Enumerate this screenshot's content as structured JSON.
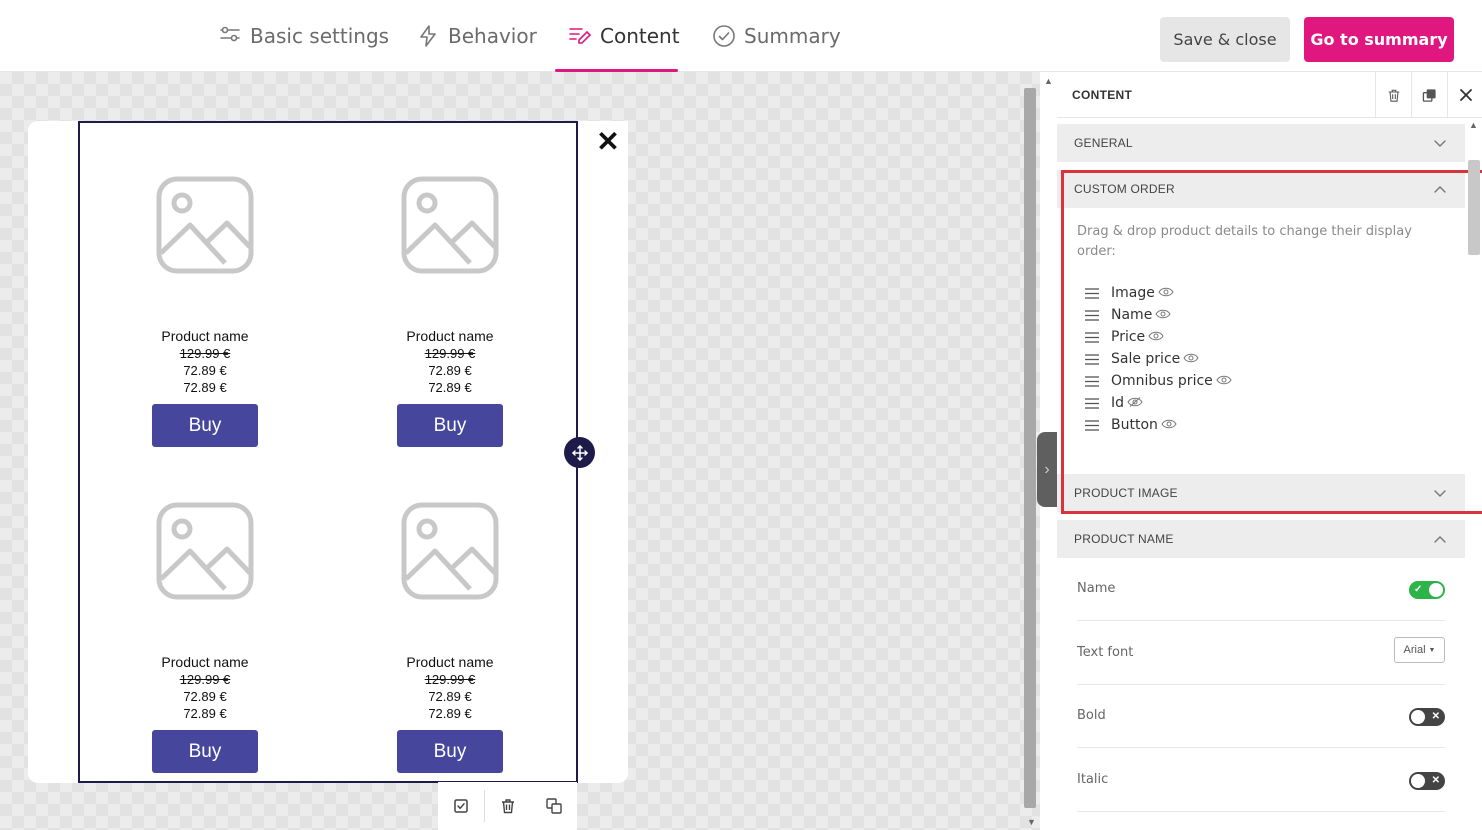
{
  "tabs": [
    {
      "label": "Basic settings",
      "icon": "sliders-icon"
    },
    {
      "label": "Behavior",
      "icon": "lightning-icon"
    },
    {
      "label": "Content",
      "icon": "content-edit-icon"
    },
    {
      "label": "Summary",
      "icon": "check-circle-icon"
    }
  ],
  "active_tab": "Content",
  "actions": {
    "save_close": "Save & close",
    "go_summary": "Go to summary"
  },
  "colors": {
    "accent": "#e0177f",
    "buy_button": "#46479c",
    "selection": "#1e1a4a",
    "toggle_on": "#2cb34a",
    "highlight": "#d9343b"
  },
  "products": [
    {
      "name": "Product name",
      "old_price": "129.99 €",
      "price": "72.89 €",
      "omnibus_price": "72.89 €",
      "button": "Buy"
    },
    {
      "name": "Product name",
      "old_price": "129.99 €",
      "price": "72.89 €",
      "omnibus_price": "72.89 €",
      "button": "Buy"
    },
    {
      "name": "Product name",
      "old_price": "129.99 €",
      "price": "72.89 €",
      "omnibus_price": "72.89 €",
      "button": "Buy"
    },
    {
      "name": "Product name",
      "old_price": "129.99 €",
      "price": "72.89 €",
      "omnibus_price": "72.89 €",
      "button": "Buy"
    }
  ],
  "canvas_close": "✕",
  "panel": {
    "title": "CONTENT",
    "sections": {
      "general": "GENERAL",
      "custom_order": "CUSTOM ORDER",
      "product_image": "PRODUCT IMAGE",
      "product_name": "PRODUCT NAME"
    },
    "custom_order_instructions": "Drag & drop product details to change their display order:",
    "order_items": [
      {
        "label": "Image",
        "visible": true
      },
      {
        "label": "Name",
        "visible": true
      },
      {
        "label": "Price",
        "visible": true
      },
      {
        "label": "Sale price",
        "visible": true
      },
      {
        "label": "Omnibus price",
        "visible": true
      },
      {
        "label": "Id",
        "visible": false
      },
      {
        "label": "Button",
        "visible": true
      }
    ],
    "product_name_settings": [
      {
        "label": "Name",
        "control": "toggle",
        "state": "on"
      },
      {
        "label": "Text font",
        "control": "select",
        "value": "Arial"
      },
      {
        "label": "Bold",
        "control": "toggle",
        "state": "off"
      },
      {
        "label": "Italic",
        "control": "toggle",
        "state": "off"
      }
    ]
  }
}
